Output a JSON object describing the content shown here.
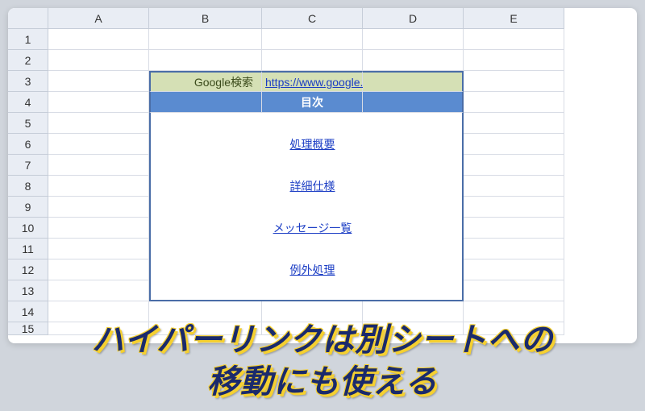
{
  "columns": [
    "A",
    "B",
    "C",
    "D",
    "E"
  ],
  "rows": [
    "1",
    "2",
    "3",
    "4",
    "5",
    "6",
    "7",
    "8",
    "9",
    "10",
    "11",
    "12",
    "13",
    "14",
    "15"
  ],
  "googleRow": {
    "label": "Google検索",
    "url": "https://www.google.co.jp/"
  },
  "heading": "目次",
  "tocLinks": {
    "link1": "処理概要",
    "link2": "詳細仕様",
    "link3": "メッセージ一覧",
    "link4": "例外処理"
  },
  "overlay": {
    "line1": "ハイパーリンクは別シートへの",
    "line2": "移動にも使える"
  }
}
